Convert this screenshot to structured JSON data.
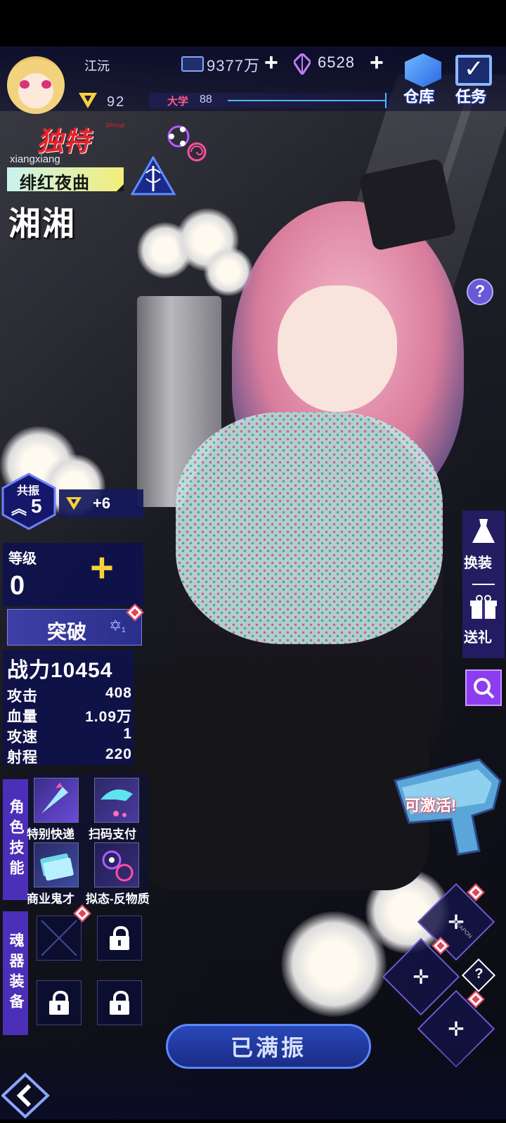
{
  "player": {
    "name": "江沅",
    "level": "92"
  },
  "resources": {
    "currency": "9377万",
    "gems": "6528"
  },
  "nav": {
    "warehouse": "仓库",
    "tasks": "任务"
  },
  "school": {
    "label": "大学",
    "value": "88"
  },
  "character": {
    "rarity": "独特",
    "rarity_sub": "SPecial",
    "id": "xiangxiang",
    "title": "绯红夜曲",
    "name": "湘湘"
  },
  "resonance": {
    "label": "共振",
    "rank": "5",
    "bonus": "+6"
  },
  "level": {
    "label": "等级",
    "value": "0"
  },
  "breakthrough": {
    "label": "突破",
    "count": "1"
  },
  "power": {
    "label": "战力",
    "value": "10454"
  },
  "stats": [
    {
      "label": "攻击",
      "value": "408"
    },
    {
      "label": "血量",
      "value": "1.09万"
    },
    {
      "label": "攻速",
      "value": "1"
    },
    {
      "label": "射程",
      "value": "220"
    }
  ],
  "skills_section": "角色技能",
  "skills": [
    {
      "label": "特别快递"
    },
    {
      "label": "扫码支付"
    },
    {
      "label": "商业鬼才"
    },
    {
      "label": "拟态-反物质"
    }
  ],
  "soul_section": "魂器装备",
  "side_buttons": {
    "outfit": "换装",
    "gift": "送礼"
  },
  "activate": "可激活!",
  "weapon_label": "WEAPON",
  "bottom_button": "已满振",
  "colors": {
    "accent_blue": "#3b6cff",
    "gold": "#f7d23a",
    "purple": "#6b4bd8",
    "rarity_red": "#e8212b"
  }
}
